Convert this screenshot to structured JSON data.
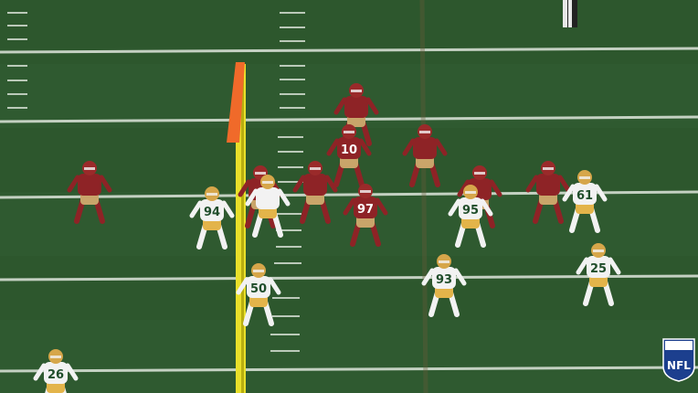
{
  "scene": {
    "type": "broadcast-still",
    "description_free": true,
    "colors": {
      "field": "#2f5a30",
      "field_dark": "#285026",
      "yard_line": "#dfe6dc",
      "home_jersey": "#8e2326",
      "home_pants": "#c9a56a",
      "away_jersey": "#f2f2f2",
      "away_pants": "#e3b44a",
      "helmet_gold": "#d6a64a",
      "pylon_pole": "#e9e02a",
      "pylon_flag": "#f06a2a"
    }
  },
  "players": {
    "home": [
      {
        "number": "10"
      },
      {
        "number": "97"
      },
      {
        "number": ""
      }
    ],
    "away": [
      {
        "number": "94"
      },
      {
        "number": "95"
      },
      {
        "number": "61"
      },
      {
        "number": "50"
      },
      {
        "number": "93"
      },
      {
        "number": "25"
      },
      {
        "number": "26"
      }
    ]
  },
  "logo": {
    "text": "NFL",
    "icon": "nfl-shield-logo"
  }
}
